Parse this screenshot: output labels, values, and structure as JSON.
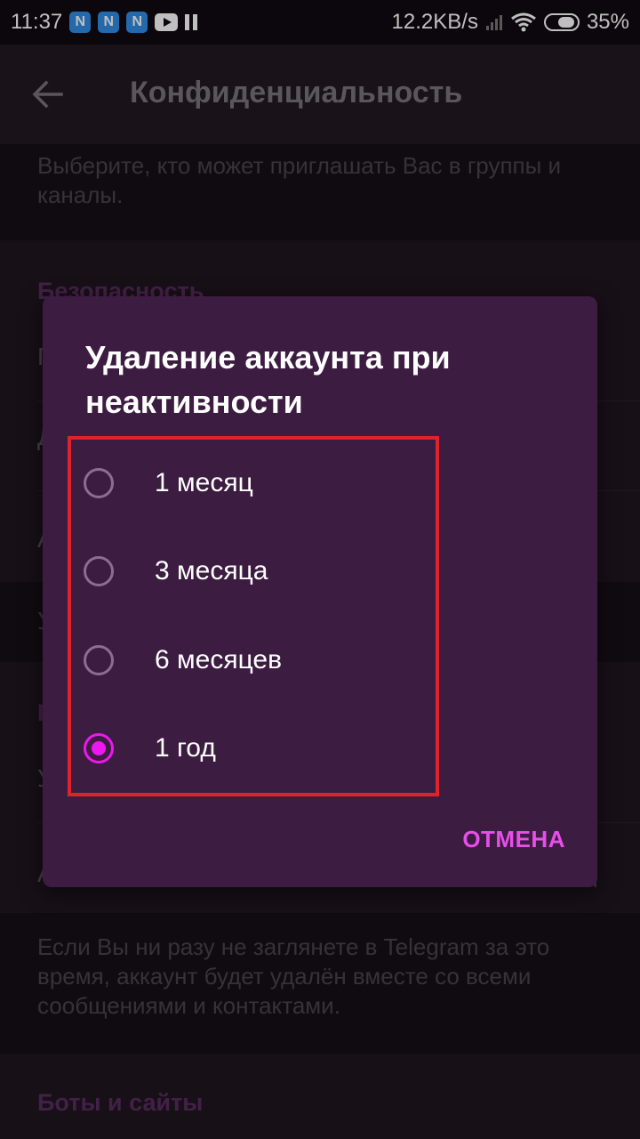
{
  "status_bar": {
    "time": "11:37",
    "notif_label": "N",
    "net_speed": "12.2KB/s",
    "battery": "35%"
  },
  "appbar": {
    "title": "Конфиденциальность"
  },
  "background": {
    "groups_hint": "Выберите, кто может приглашать Вас в группы и каналы.",
    "security_title": "Безопасность",
    "partial_rows": [
      "П",
      "Д",
      "А",
      "У",
      "П",
      "У",
      "А"
    ],
    "partial_row_right": "д",
    "delete_hint": "Если Вы ни разу не заглянете в Telegram за это время, аккаунт будет удалён вместе со всеми сообщениями и контактами.",
    "bots_title": "Боты и сайты"
  },
  "dialog": {
    "title": "Удаление аккаунта при неактивности",
    "options": [
      {
        "label": "1 месяц",
        "checked": false
      },
      {
        "label": "3 месяца",
        "checked": false
      },
      {
        "label": "6 месяцев",
        "checked": false
      },
      {
        "label": "1 год",
        "checked": true
      }
    ],
    "cancel_label": "ОТМЕНА"
  },
  "colors": {
    "accent": "#ef17f0",
    "highlight_box": "#e0222c",
    "dialog_bg": "#3d1c41"
  }
}
